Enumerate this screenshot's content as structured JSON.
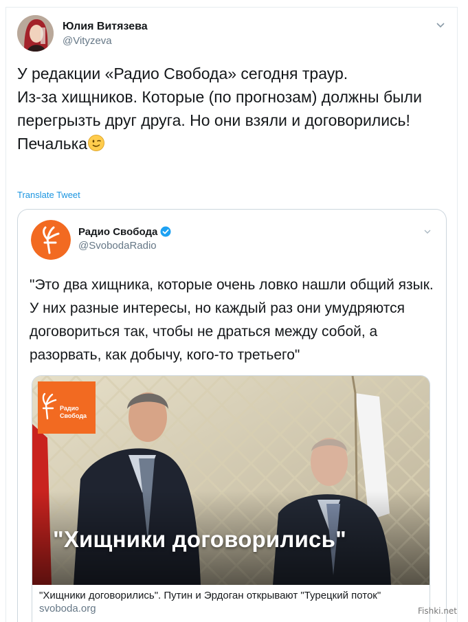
{
  "tweet": {
    "author_name": "Юлия Витязева",
    "author_handle": "@Vityzeva",
    "text": "У редакции «Радио Свобода» сегодня траур.\nИз-за хищников. Которые (по прогнозам) должны были перегрызть друг друга. Но они взяли и договорились!\nПечалька",
    "emoji": "winking-face-icon",
    "translate_label": "Translate Tweet"
  },
  "quoted_tweet": {
    "author_name": "Радио Свобода",
    "author_handle": "@SvobodaRadio",
    "verified": true,
    "text": "\"Это два хищника, которые очень ловко нашли общий язык. У них разные интересы, но каждый раз они умудряются договориться так, чтобы не драться между собой, а разорвать, как добычу, кого-то третьего\"",
    "card": {
      "image_headline": "\"Хищники договорились\"",
      "image_logo_text": "Радио\nСвобода",
      "caption": "\"Хищники договорились\". Путин и Эрдоган открывают \"Турецкий поток\"",
      "domain": "svoboda.org"
    }
  },
  "watermark": "Fishki.net",
  "colors": {
    "text": "#14171a",
    "secondary": "#657786",
    "link": "#1b95e0",
    "border": "#ccd6dd",
    "brand_orange": "#f26a21",
    "verified_blue": "#1da1f2"
  }
}
